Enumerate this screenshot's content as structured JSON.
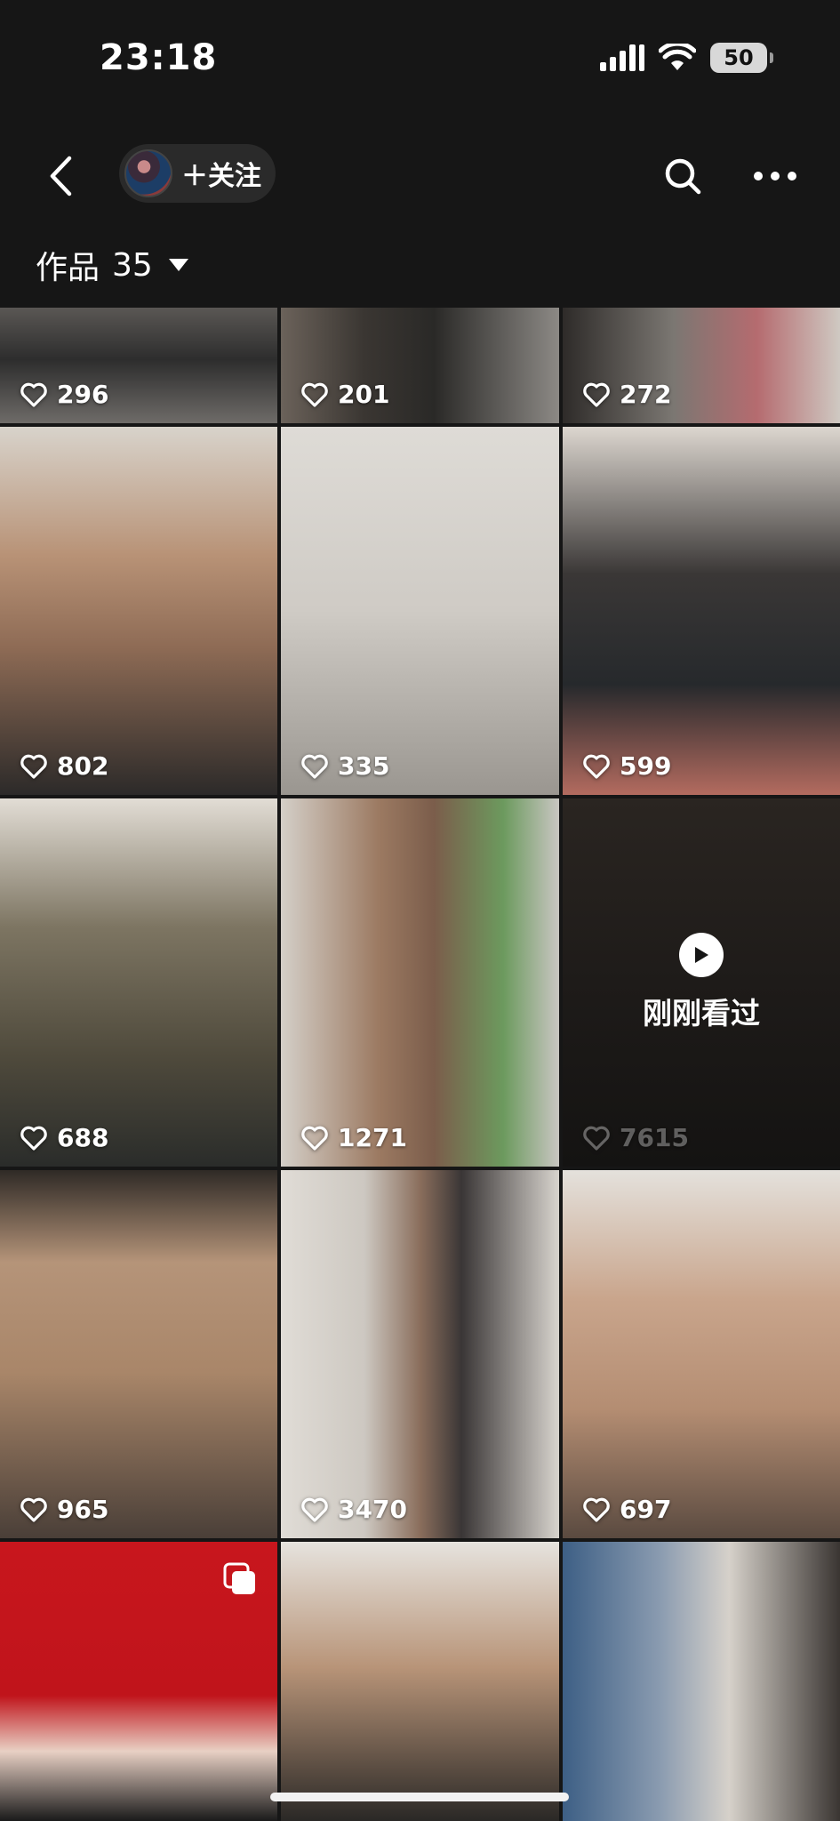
{
  "status": {
    "time": "23:18",
    "battery": "50"
  },
  "nav": {
    "follow_label": "＋关注"
  },
  "works": {
    "label": "作品",
    "count": "35"
  },
  "colors": {
    "background": "#161616",
    "pill": "#2a2a2a"
  },
  "videos": [
    {
      "likes": "296"
    },
    {
      "likes": "201"
    },
    {
      "likes": "272"
    },
    {
      "likes": "802"
    },
    {
      "likes": "335"
    },
    {
      "likes": "599"
    },
    {
      "likes": "688"
    },
    {
      "likes": "1271"
    },
    {
      "likes": "7615",
      "watched_label": "刚刚看过"
    },
    {
      "likes": "965"
    },
    {
      "likes": "3470"
    },
    {
      "likes": "697"
    },
    {
      "icon": "multi-image-icon"
    },
    {},
    {}
  ]
}
